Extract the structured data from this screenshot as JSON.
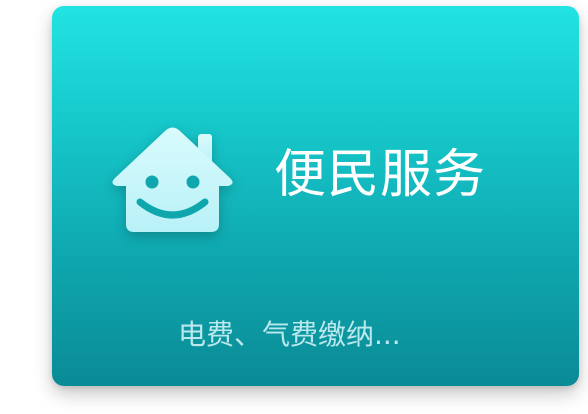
{
  "card": {
    "title": "便民服务",
    "subtitle": "电费、气费缴纳...",
    "icon": "smiling-house-icon"
  },
  "colors": {
    "gradient_top": "#22e3e3",
    "gradient_bottom": "#0a8b96",
    "title": "#ffffff",
    "icon_fill": "#c6f6fb"
  }
}
